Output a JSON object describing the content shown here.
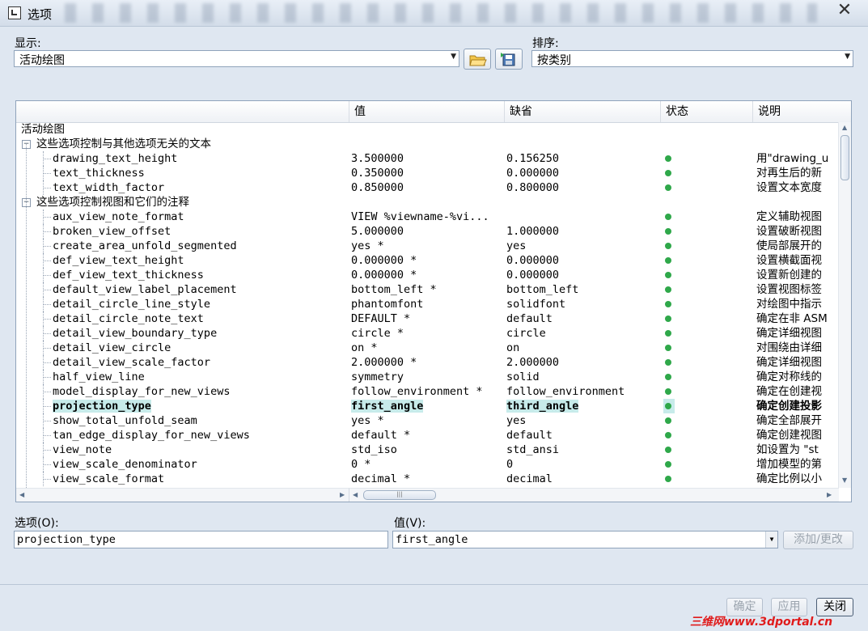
{
  "window": {
    "title": "选项",
    "close_glyph": "✕"
  },
  "display": {
    "label": "显示:",
    "value": "活动绘图"
  },
  "sort": {
    "label": "排序:",
    "value": "按类别"
  },
  "table": {
    "columns": [
      "值",
      "缺省",
      "状态",
      "说明"
    ],
    "root": "活动绘图",
    "groups": [
      {
        "title": "这些选项控制与其他选项无关的文本",
        "rows": [
          {
            "name": "drawing_text_height",
            "value": "3.500000",
            "default": "0.156250",
            "desc": "用\"drawing_u"
          },
          {
            "name": "text_thickness",
            "value": "0.350000",
            "default": "0.000000",
            "desc": "对再生后的新"
          },
          {
            "name": "text_width_factor",
            "value": "0.850000",
            "default": "0.800000",
            "desc": "设置文本宽度"
          }
        ]
      },
      {
        "title": "这些选项控制视图和它们的注释",
        "rows": [
          {
            "name": "aux_view_note_format",
            "value": "VIEW %viewname-%vi...",
            "default": "",
            "desc": "定义辅助视图"
          },
          {
            "name": "broken_view_offset",
            "value": "5.000000",
            "default": "1.000000",
            "desc": "设置破断视图"
          },
          {
            "name": "create_area_unfold_segmented",
            "value": "yes *",
            "default": "yes",
            "desc": "使局部展开的"
          },
          {
            "name": "def_view_text_height",
            "value": "0.000000 *",
            "default": "0.000000",
            "desc": "设置横截面视"
          },
          {
            "name": "def_view_text_thickness",
            "value": "0.000000 *",
            "default": "0.000000",
            "desc": "设置新创建的"
          },
          {
            "name": "default_view_label_placement",
            "value": "bottom_left *",
            "default": "bottom_left",
            "desc": "设置视图标签"
          },
          {
            "name": "detail_circle_line_style",
            "value": "phantomfont",
            "default": "solidfont",
            "desc": "对绘图中指示"
          },
          {
            "name": "detail_circle_note_text",
            "value": "DEFAULT *",
            "default": "default",
            "desc": "确定在非 ASM"
          },
          {
            "name": "detail_view_boundary_type",
            "value": "circle *",
            "default": "circle",
            "desc": "确定详细视图"
          },
          {
            "name": "detail_view_circle",
            "value": "on *",
            "default": "on",
            "desc": "对围绕由详细"
          },
          {
            "name": "detail_view_scale_factor",
            "value": "2.000000 *",
            "default": "2.000000",
            "desc": "确定详细视图"
          },
          {
            "name": "half_view_line",
            "value": "symmetry",
            "default": "solid",
            "desc": "确定对称线的"
          },
          {
            "name": "model_display_for_new_views",
            "value": "follow_environment *",
            "default": "follow_environment",
            "desc": "确定在创建视"
          },
          {
            "name": "projection_type",
            "value": "first_angle",
            "default": "third_angle",
            "desc": "确定创建投影",
            "selected": true
          },
          {
            "name": "show_total_unfold_seam",
            "value": "yes *",
            "default": "yes",
            "desc": "确定全部展开"
          },
          {
            "name": "tan_edge_display_for_new_views",
            "value": "default *",
            "default": "default",
            "desc": "确定创建视图"
          },
          {
            "name": "view_note",
            "value": "std_iso",
            "default": "std_ansi",
            "desc": "如设置为 \"st"
          },
          {
            "name": "view_scale_denominator",
            "value": "0 *",
            "default": "0",
            "desc": "增加模型的第"
          },
          {
            "name": "view_scale_format",
            "value": "decimal *",
            "default": "decimal",
            "desc": "确定比例以小"
          }
        ]
      }
    ]
  },
  "option": {
    "label": "选项(O):",
    "value": "projection_type"
  },
  "value": {
    "label": "值(V):",
    "value": "first_angle"
  },
  "buttons": {
    "add_change": "添加/更改",
    "ok": "确定",
    "apply": "应用",
    "close": "关闭"
  },
  "watermark": "三维网www.3dportal.cn",
  "colors": {
    "selection": "#c7ebea",
    "status_ok": "#2fa84a",
    "watermark": "#e01b1b"
  }
}
